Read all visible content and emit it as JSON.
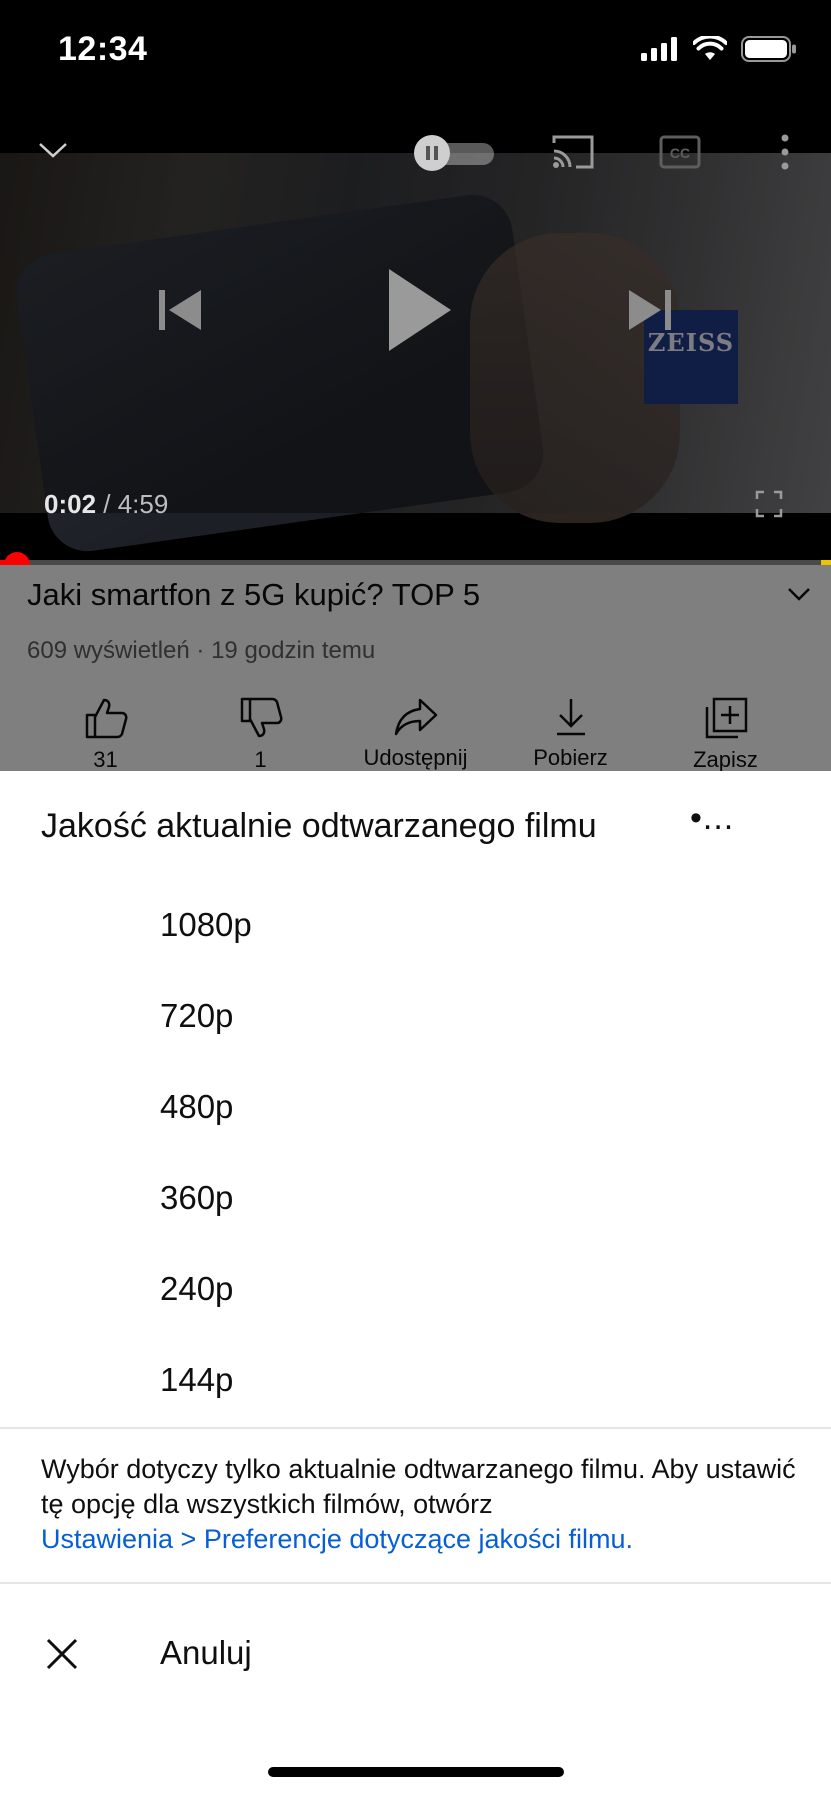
{
  "status_bar": {
    "time": "12:34"
  },
  "player": {
    "current_time": "0:02",
    "separator": " / ",
    "duration": "4:59",
    "watermark": "ZEISS",
    "progress_fraction": 0.007
  },
  "video": {
    "title": "Jaki smartfon z 5G kupić? TOP 5",
    "meta": "609 wyświetleń · 19 godzin temu",
    "actions": [
      {
        "label": "31",
        "icon": "thumbs-up-icon"
      },
      {
        "label": "1",
        "icon": "thumbs-down-icon"
      },
      {
        "label": "Udostępnij",
        "icon": "share-icon"
      },
      {
        "label": "Pobierz",
        "icon": "download-icon"
      },
      {
        "label": "Zapisz",
        "icon": "save-to-playlist-icon"
      }
    ]
  },
  "quality_sheet": {
    "title": "Jakość aktualnie odtwarzanego filmu",
    "more": "•...",
    "options": [
      "1080p",
      "720p",
      "480p",
      "360p",
      "240p",
      "144p"
    ],
    "notice": "Wybór dotyczy tylko aktualnie odtwarzanego filmu. Aby ustawić tę opcję dla wszystkich filmów, otwórz",
    "notice_link": "Ustawienia > Preferencje dotyczące jakości filmu.",
    "cancel": "Anuluj",
    "link_color": "#065fd4"
  }
}
